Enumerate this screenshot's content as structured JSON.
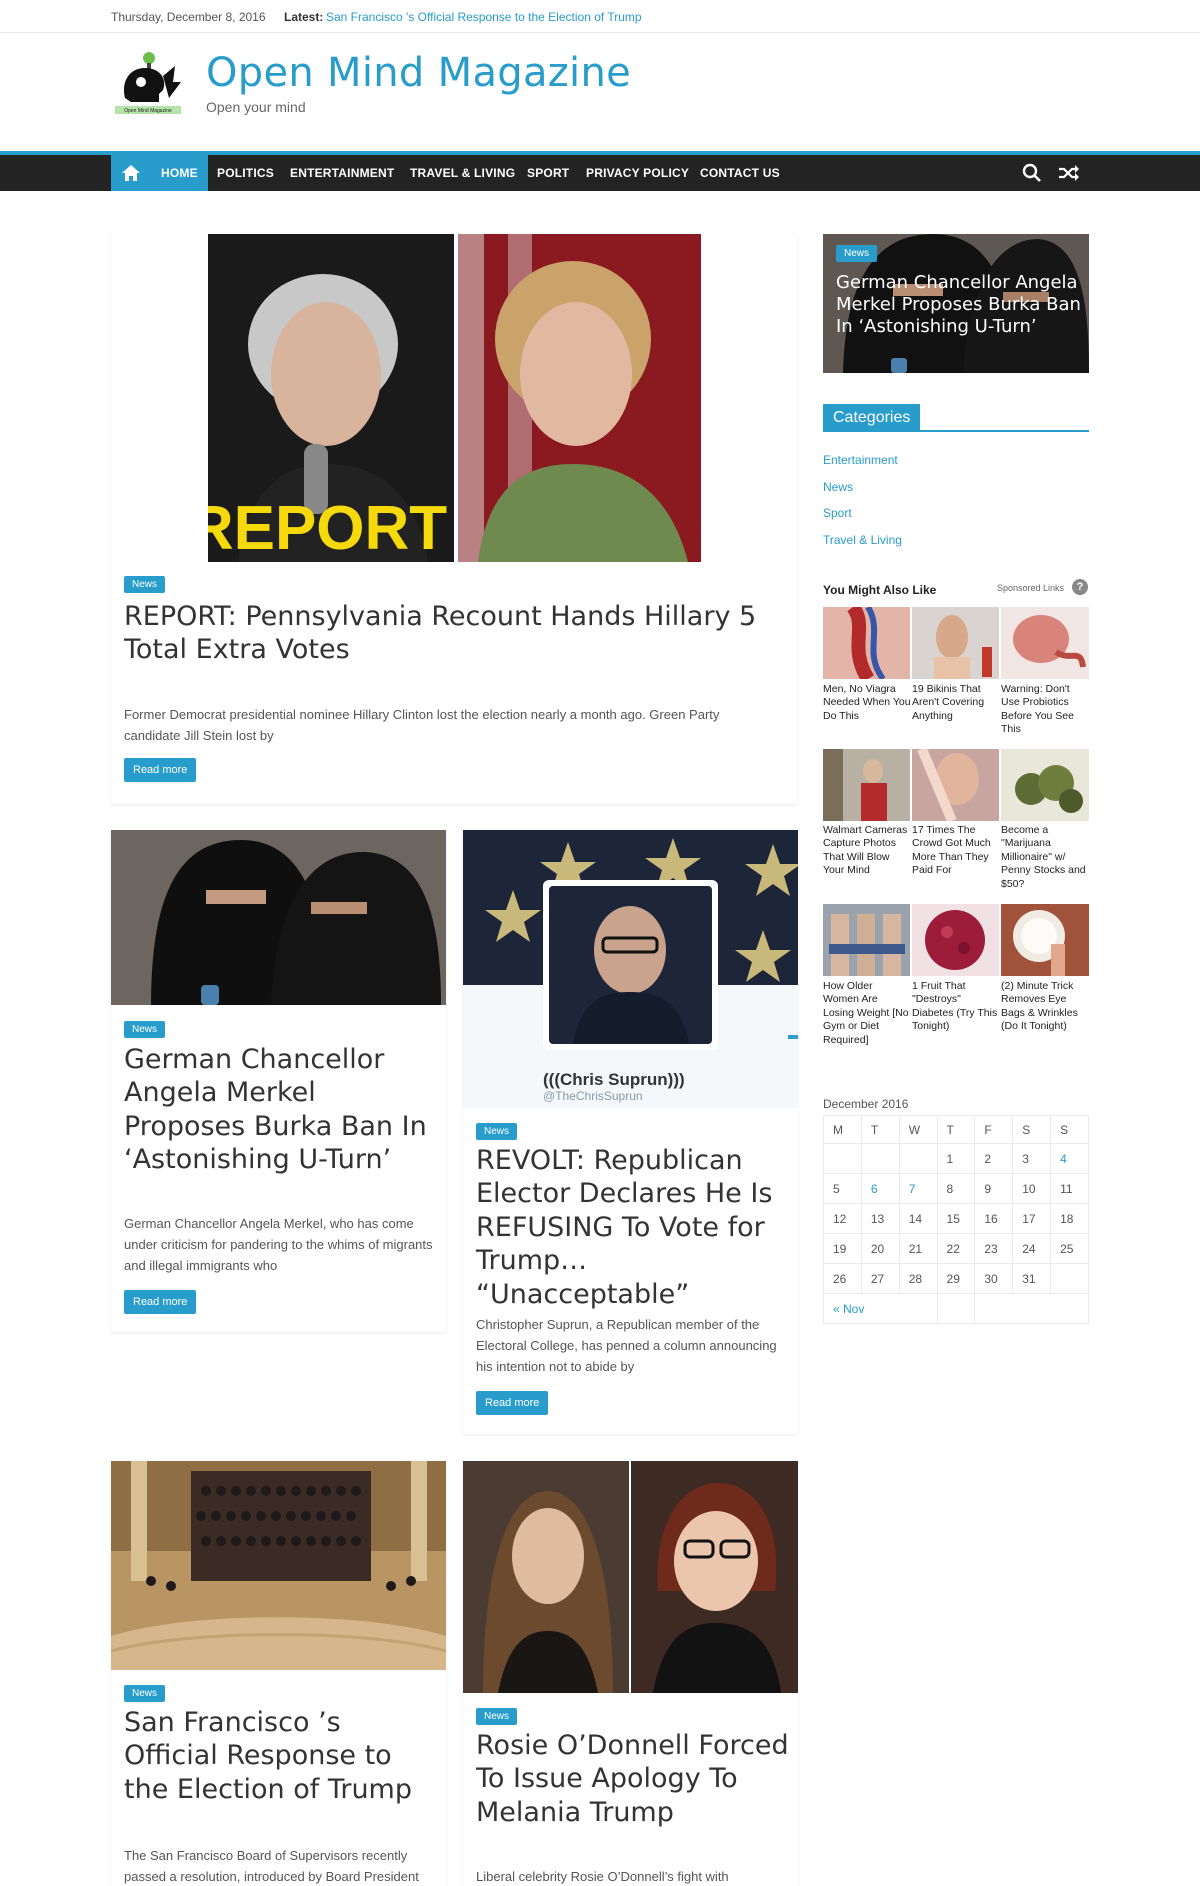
{
  "topbar": {
    "date": "Thursday, December 8, 2016",
    "latest_label": "Latest:",
    "latest_link": "San Francisco 's Official Response to the Election of Trump"
  },
  "header": {
    "title": "Open Mind Magazine",
    "tagline": "Open your mind",
    "logo_caption": "Open Mind Magazine"
  },
  "nav": {
    "items": [
      "HOME",
      "POLITICS",
      "ENTERTAINMENT",
      "TRAVEL & LIVING",
      "SPORT",
      "PRIVACY POLICY",
      "CONTACT US"
    ]
  },
  "posts": {
    "featured": {
      "badge": "News",
      "image_text": "REPORT",
      "title": "REPORT: Pennsylvania Recount Hands Hillary 5 Total Extra Votes",
      "excerpt": "Former Democrat presidential nominee Hillary Clinton lost the election nearly a month ago. Green Party candidate Jill Stein lost by",
      "read_more": "Read more"
    },
    "merkel": {
      "badge": "News",
      "title": "German Chancellor Angela Merkel Proposes Burka Ban In ‘Astonishing U-Turn’",
      "excerpt": "German Chancellor Angela Merkel, who has come under criticism for pandering to the whims of migrants and illegal immigrants who",
      "read_more": "Read more"
    },
    "revolt": {
      "badge": "News",
      "profile_name": "(((Chris Suprun)))",
      "profile_handle": "@TheChrisSuprun",
      "title": "REVOLT: Republican Elector Declares He Is REFUSING To Vote for Trump… “Unacceptable”",
      "excerpt": "Christopher Suprun, a Republican member of the Electoral College, has penned a column announcing his intention not to abide by",
      "read_more": "Read more"
    },
    "sf": {
      "badge": "News",
      "title": "San Francisco ’s Official Response to the Election of Trump",
      "excerpt": "The San Francisco Board of Supervisors recently passed a resolution, introduced by Board President"
    },
    "rosie": {
      "badge": "News",
      "title": "Rosie O’Donnell Forced To Issue Apology To Melania Trump",
      "excerpt": "Liberal celebrity Rosie O’Donnell’s fight with"
    }
  },
  "sidebar": {
    "feature": {
      "badge": "News",
      "title": "German Chancellor Angela Merkel Proposes Burka Ban In ‘Astonishing U-Turn’"
    },
    "categories": {
      "heading": "Categories",
      "items": [
        "Entertainment",
        "News",
        "Sport",
        "Travel & Living"
      ]
    },
    "ymal": {
      "title": "You Might Also Like",
      "sponsored": "Sponsored Links",
      "help": "?",
      "items": [
        "Men, No Viagra Needed When You Do This",
        "19 Bikinis That Aren't Covering Anything",
        "Warning: Don't Use Probiotics Before You See This",
        "Walmart Cameras Capture Photos That Will Blow Your Mind",
        "17 Times The Crowd Got Much More Than They Paid For",
        "Become a \"Marijuana Millionaire\" w/ Penny Stocks and $50?",
        "How Older Women Are Losing Weight [No Gym or Diet Required]",
        "1 Fruit That \"Destroys\" Diabetes (Try This Tonight)",
        "(2) Minute Trick Removes Eye Bags & Wrinkles (Do It Tonight)"
      ]
    },
    "calendar": {
      "caption": "December 2016",
      "days": [
        "M",
        "T",
        "W",
        "T",
        "F",
        "S",
        "S"
      ],
      "weeks": [
        [
          "",
          "",
          "",
          "1",
          "2",
          "3",
          "4"
        ],
        [
          "5",
          "6",
          "7",
          "8",
          "9",
          "10",
          "11"
        ],
        [
          "12",
          "13",
          "14",
          "15",
          "16",
          "17",
          "18"
        ],
        [
          "19",
          "20",
          "21",
          "22",
          "23",
          "24",
          "25"
        ],
        [
          "26",
          "27",
          "28",
          "29",
          "30",
          "31",
          ""
        ]
      ],
      "linked_days": [
        "4",
        "6",
        "7"
      ],
      "prev": "« Nov"
    }
  },
  "colors": {
    "accent": "#289dcc",
    "nav_bg": "#232323"
  }
}
